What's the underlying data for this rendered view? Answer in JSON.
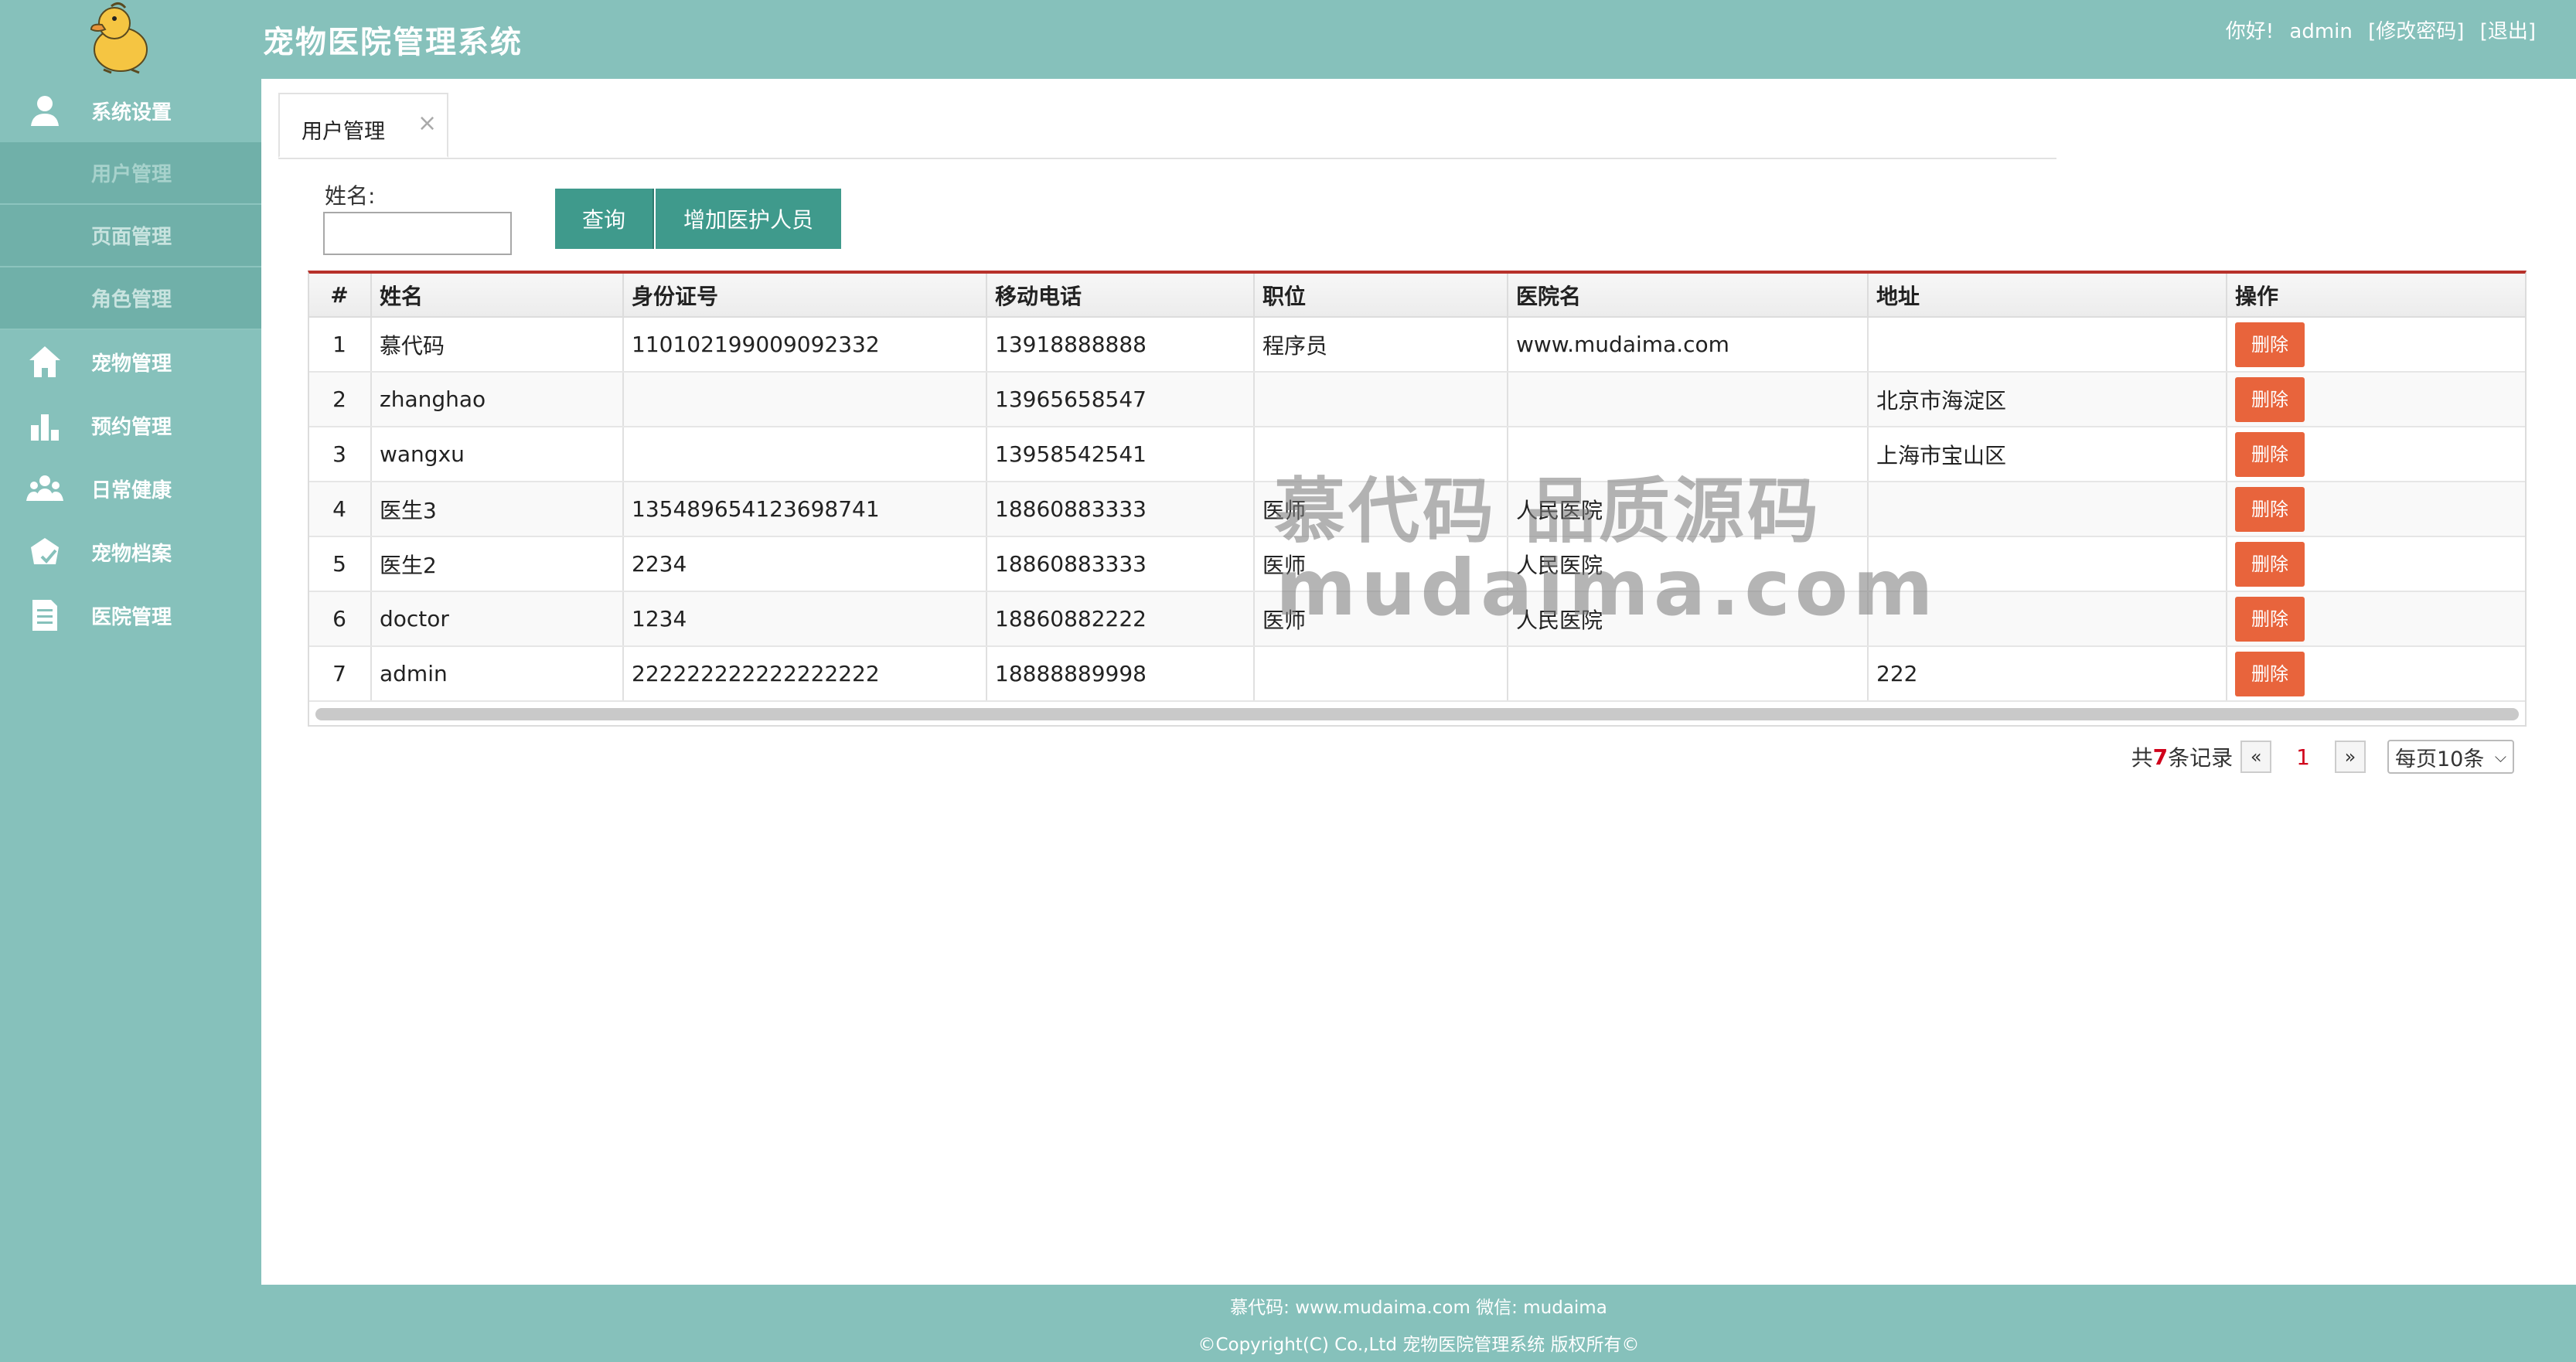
{
  "header": {
    "title": "宠物医院管理系统",
    "greeting": "你好!",
    "username": "admin",
    "change_password": "[修改密码]",
    "logout": "[退出]"
  },
  "sidebar": {
    "groups": [
      {
        "label": "系统设置",
        "icon": "user-icon"
      },
      {
        "label": "宠物管理",
        "icon": "home-icon"
      },
      {
        "label": "预约管理",
        "icon": "bar-chart-icon"
      },
      {
        "label": "日常健康",
        "icon": "group-icon"
      },
      {
        "label": "宠物档案",
        "icon": "pet-file-icon"
      },
      {
        "label": "医院管理",
        "icon": "document-icon"
      }
    ],
    "sub_items": [
      "用户管理",
      "页面管理",
      "角色管理"
    ]
  },
  "tabs": [
    {
      "label": "用户管理",
      "close": "×"
    }
  ],
  "search": {
    "name_label": "姓名:",
    "name_value": "",
    "query_button": "查询",
    "add_button": "增加医护人员"
  },
  "table": {
    "columns": [
      "#",
      "姓名",
      "身份证号",
      "移动电话",
      "职位",
      "医院名",
      "地址",
      "操作"
    ],
    "rows": [
      {
        "idx": "1",
        "name": "慕代码",
        "id_card": "110102199009092332",
        "phone": "13918888888",
        "position": "程序员",
        "hospital": "www.mudaima.com",
        "address": "",
        "action": "删除"
      },
      {
        "idx": "2",
        "name": "zhanghao",
        "id_card": "",
        "phone": "13965658547",
        "position": "",
        "hospital": "",
        "address": "北京市海淀区",
        "action": "删除"
      },
      {
        "idx": "3",
        "name": "wangxu",
        "id_card": "",
        "phone": "13958542541",
        "position": "",
        "hospital": "",
        "address": "上海市宝山区",
        "action": "删除"
      },
      {
        "idx": "4",
        "name": "医生3",
        "id_card": "135489654123698741",
        "phone": "18860883333",
        "position": "医师",
        "hospital": "人民医院",
        "address": "",
        "action": "删除"
      },
      {
        "idx": "5",
        "name": "医生2",
        "id_card": "2234",
        "phone": "18860883333",
        "position": "医师",
        "hospital": "人民医院",
        "address": "",
        "action": "删除"
      },
      {
        "idx": "6",
        "name": "doctor",
        "id_card": "1234",
        "phone": "18860882222",
        "position": "医师",
        "hospital": "人民医院",
        "address": "",
        "action": "删除"
      },
      {
        "idx": "7",
        "name": "admin",
        "id_card": "222222222222222222",
        "phone": "18888889998",
        "position": "",
        "hospital": "",
        "address": "222",
        "action": "删除"
      }
    ]
  },
  "pagination": {
    "prefix": "共",
    "count": "7",
    "suffix": "条记录",
    "prev": "«",
    "current": "1",
    "next": "»",
    "page_size": "每页10条"
  },
  "watermark": {
    "line1": "慕代码 品质源码",
    "line2": "mudaima.com"
  },
  "footer": {
    "line1": "慕代码: www.mudaima.com 微信: mudaima",
    "line2": "©Copyright(C) Co.,Ltd 宠物医院管理系统 版权所有©"
  },
  "colors": {
    "theme": "#86c1bb",
    "button": "#3f9a8c",
    "delete": "#e8643c",
    "table_top_border": "#b7312a"
  }
}
